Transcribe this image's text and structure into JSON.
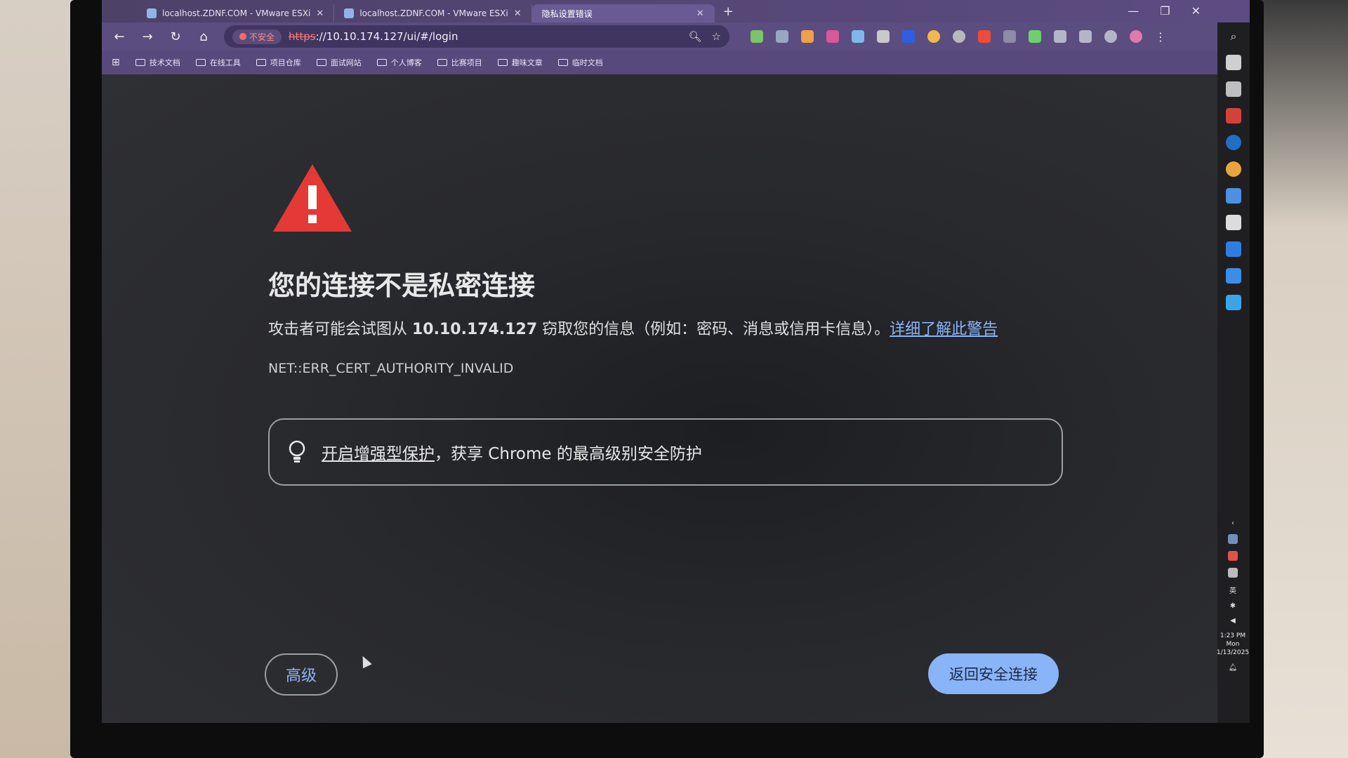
{
  "tabs": [
    {
      "label": "localhost.ZDNF.COM - VMware ESXi",
      "active": false
    },
    {
      "label": "localhost.ZDNF.COM - VMware ESXi",
      "active": false
    },
    {
      "label": "隐私设置错误",
      "active": true
    }
  ],
  "toolbar": {
    "security_chip": "不安全",
    "url_scheme": "https",
    "url_rest": "://10.10.174.127/ui/#/login"
  },
  "bookmarks": [
    "技术文档",
    "在线工具",
    "项目仓库",
    "面试网站",
    "个人博客",
    "比赛项目",
    "趣味文章",
    "临时文档"
  ],
  "error": {
    "title": "您的连接不是私密连接",
    "desc_prefix": "攻击者可能会试图从 ",
    "host": "10.10.174.127",
    "desc_suffix": " 窃取您的信息（例如：密码、消息或信用卡信息）。",
    "learn_more": "详细了解此警告",
    "code": "NET::ERR_CERT_AUTHORITY_INVALID"
  },
  "protection": {
    "link": "开启增强型保护",
    "rest": "，获享 Chrome 的最高级别安全防护"
  },
  "buttons": {
    "advanced": "高级",
    "back_to_safety": "返回安全连接"
  },
  "tray": {
    "ime": "英",
    "time": "1:23 PM",
    "day": "Mon",
    "date": "1/13/2025"
  },
  "colors": {
    "accent": "#8ab4f8",
    "warning_red": "#e53935",
    "browser_frame": "#5b4d80"
  }
}
